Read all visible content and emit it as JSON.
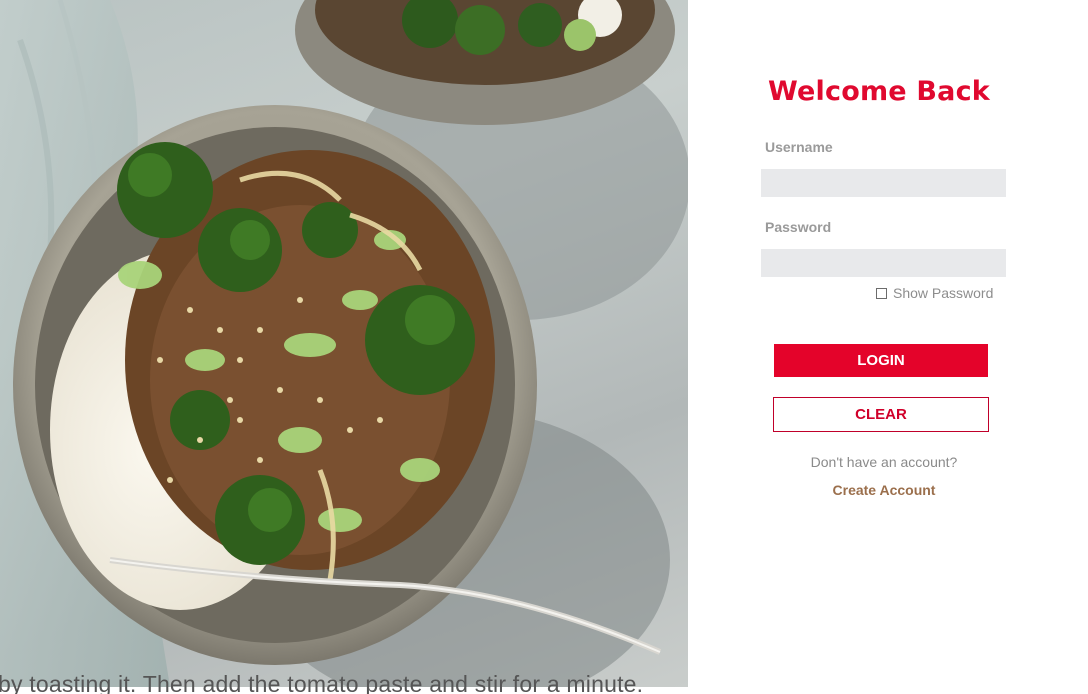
{
  "photo": {
    "alt": "Beef and broccoli rice bowl",
    "overflow_text": "by toasting it. Then add the tomato paste and stir for a minute."
  },
  "login": {
    "title": "Welcome Back",
    "username_label": "Username",
    "username_value": "",
    "password_label": "Password",
    "password_value": "",
    "show_password_label": "Show Password",
    "show_password_checked": false,
    "login_button": "LOGIN",
    "clear_button": "CLEAR",
    "no_account_text": "Don't have an account?",
    "create_account_link": "Create Account"
  },
  "colors": {
    "brand_red": "#e4032a",
    "title_red": "#e0092f",
    "link_brown": "#9b6f4c",
    "field_bg": "#e8e9eb"
  }
}
